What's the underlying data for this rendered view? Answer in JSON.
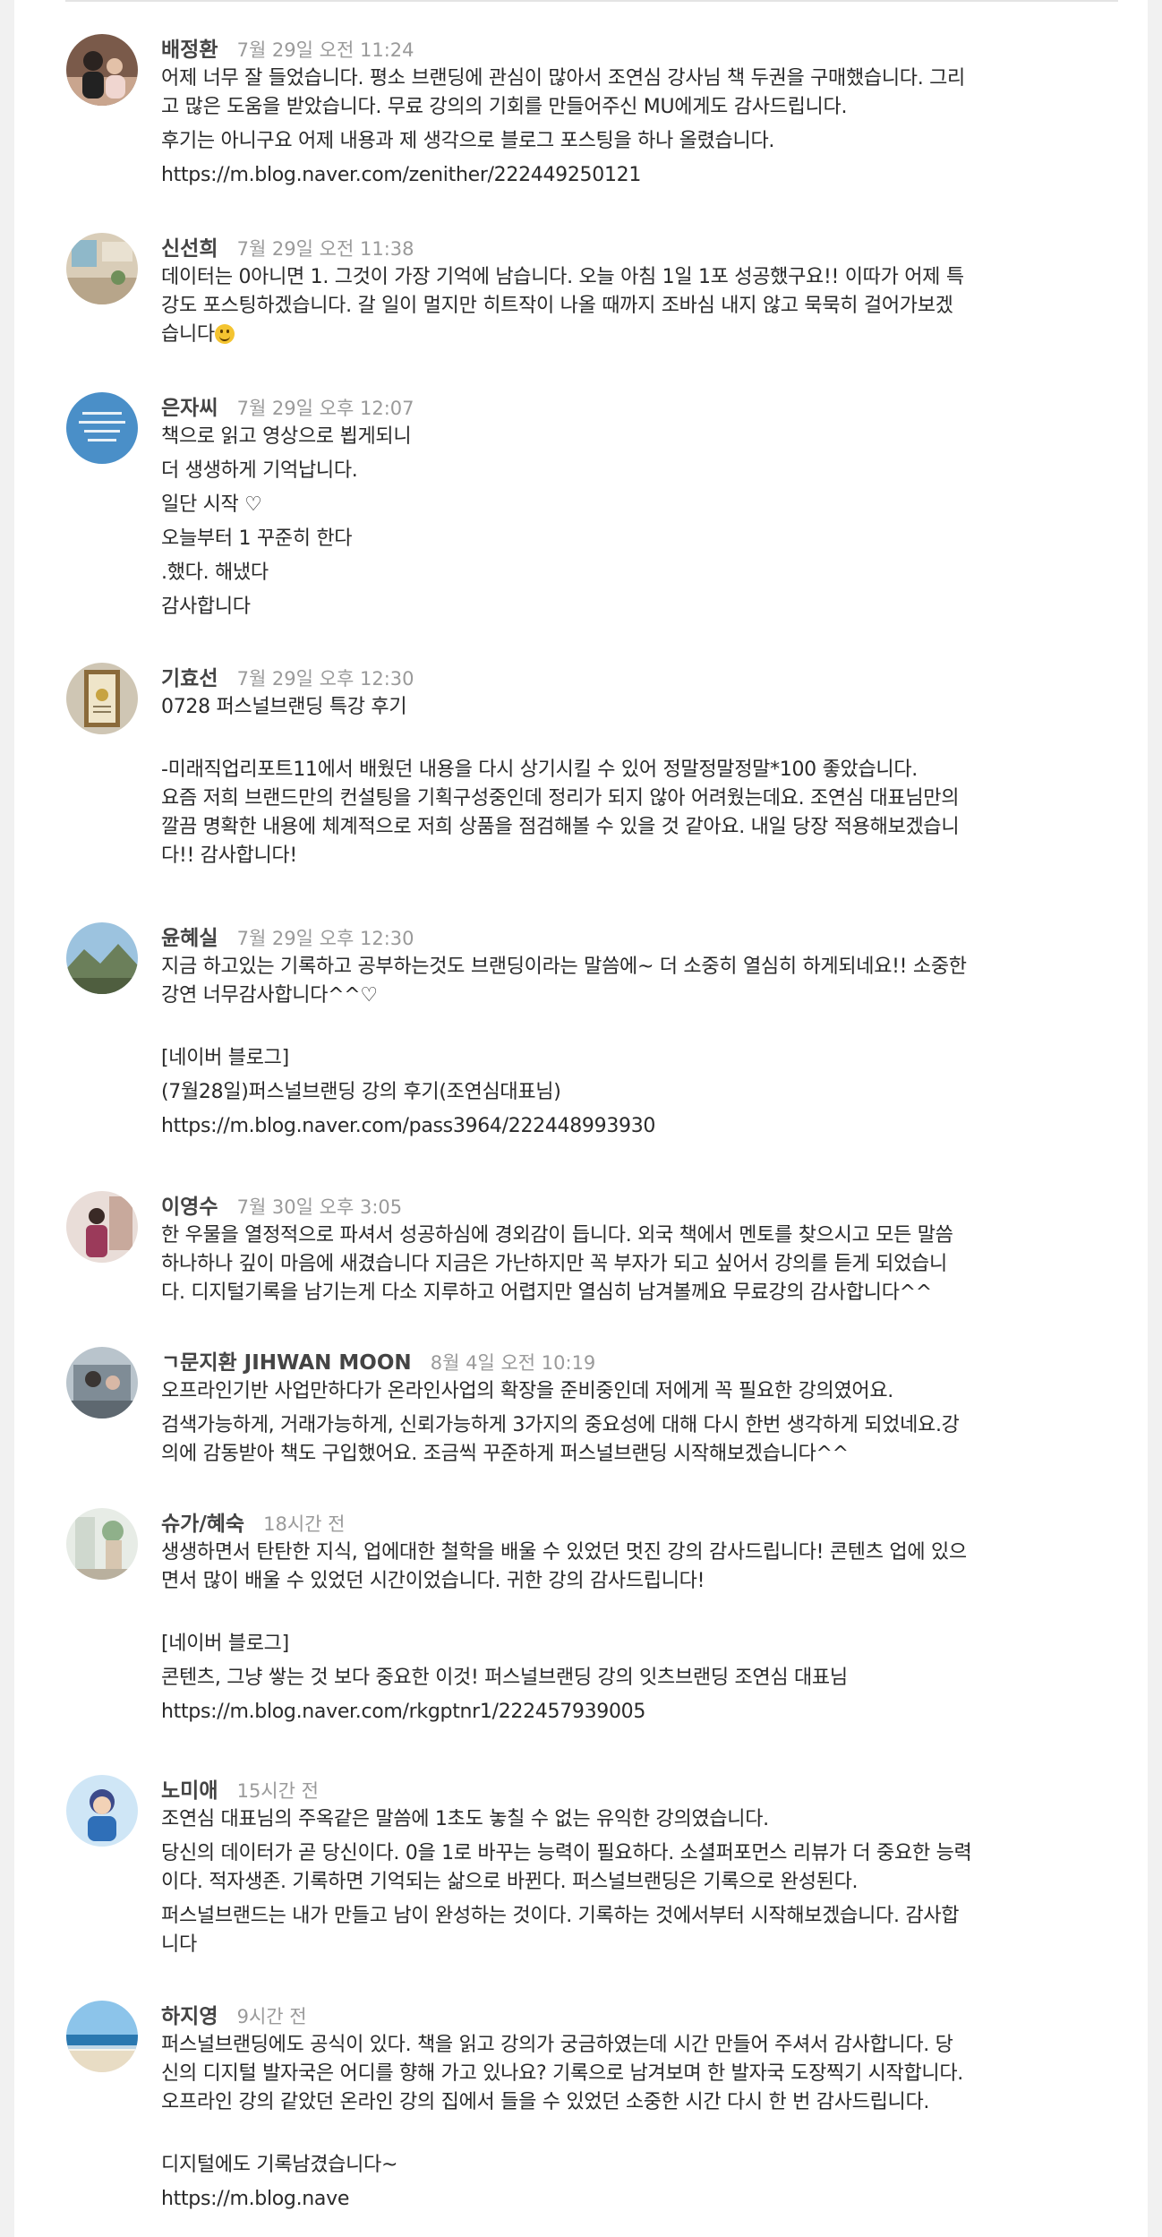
{
  "comments": [
    {
      "author": "배정환",
      "time": "7월 29일 오전 11:24",
      "paragraphs": [
        [
          "어제 너무 잘 들었습니다. 평소 브랜딩에 관심이 많아서 조연심 강사님 책 두권을 구매했습니다. 그리",
          "고 많은 도움을 받았습니다. 무료 강의의 기회를 만들어주신 MU에게도 감사드립니다."
        ],
        [
          "후기는 아니구요 어제 내용과 제 생각으로 블로그 포스팅을 하나 올렸습니다."
        ],
        [
          "https://m.blog.naver.com/zenither/222449250121"
        ]
      ]
    },
    {
      "author": "신선희",
      "time": "7월 29일 오전 11:38",
      "paragraphs": [
        [
          "데이터는 0아니면 1. 그것이 가장 기억에 남습니다. 오늘 아침 1일 1포 성공했구요!! 이따가 어제 특",
          "강도 포스팅하겠습니다. 갈 일이 멀지만 히트작이 나올 때까지 조바심 내지 않고 묵묵히 걸어가보겠",
          "습니다"
        ]
      ],
      "emoji": "grinning-face"
    },
    {
      "author": "은자씨",
      "time": "7월 29일 오후 12:07",
      "paragraphs": [
        [
          "책으로 읽고 영상으로 뵙게되니"
        ],
        [
          "더 생생하게 기억납니다."
        ],
        [
          "일단 시작 ♡"
        ],
        [
          "오늘부터 1 꾸준히 한다"
        ],
        [
          ".했다. 해냈다"
        ],
        [
          "감사합니다"
        ]
      ]
    },
    {
      "author": "기효선",
      "time": "7월 29일 오후 12:30",
      "paragraphs": [
        [
          "0728 퍼스널브랜딩 특강 후기"
        ],
        [
          "-미래직업리포트11에서 배웠던 내용을 다시 상기시킬 수 있어 정말정말정말*100 좋았습니다.",
          "요즘 저희 브랜드만의 컨설팅을 기획구성중인데 정리가 되지 않아 어려웠는데요. 조연심 대표님만의",
          "깔끔 명확한 내용에 체계적으로 저희 상품을 점검해볼 수 있을 것 같아요. 내일 당장 적용해보겠습니",
          "다!! 감사합니다!"
        ]
      ]
    },
    {
      "author": "윤혜실",
      "time": "7월 29일 오후 12:30",
      "paragraphs": [
        [
          "지금 하고있는 기록하고 공부하는것도 브랜딩이라는 말씀에~ 더 소중히 열심히 하게되네요!! 소중한",
          "강연 너무감사합니다^^♡"
        ],
        [
          "[네이버 블로그]"
        ],
        [
          "(7월28일)퍼스널브랜딩 강의 후기(조연심대표님)"
        ],
        [
          "https://m.blog.naver.com/pass3964/222448993930"
        ]
      ]
    },
    {
      "author": "이영수",
      "time": "7월 30일 오후 3:05",
      "paragraphs": [
        [
          "한 우물을 열정적으로 파셔서 성공하심에 경외감이 듭니다. 외국 책에서 멘토를 찾으시고 모든 말씀",
          "하나하나 깊이 마음에 새겼습니다 지금은 가난하지만 꼭 부자가 되고 싶어서 강의를 듣게 되었습니",
          "다. 디지털기록을 남기는게 다소 지루하고 어렵지만 열심히 남겨볼께요 무료강의 감사합니다^^"
        ]
      ]
    },
    {
      "author": "ㄱ문지환 JIHWAN MOON",
      "time": "8월 4일 오전 10:19",
      "paragraphs": [
        [
          "오프라인기반 사업만하다가 온라인사업의 확장을 준비중인데 저에게 꼭 필요한 강의였어요."
        ],
        [
          "검색가능하게, 거래가능하게, 신뢰가능하게 3가지의 중요성에 대해 다시 한번 생각하게 되었네요.강",
          "의에 감동받아 책도 구입했어요. 조금씩 꾸준하게 퍼스널브랜딩 시작해보겠습니다^^"
        ]
      ]
    },
    {
      "author": "슈가/혜숙",
      "time": "18시간 전",
      "paragraphs": [
        [
          "생생하면서 탄탄한 지식, 업에대한 철학을 배울 수 있었던 멋진 강의 감사드립니다! 콘텐츠 업에 있으",
          "면서 많이 배울 수 있었던 시간이었습니다. 귀한 강의 감사드립니다!"
        ],
        [
          "[네이버 블로그]"
        ],
        [
          "콘텐츠, 그냥 쌓는 것 보다 중요한 이것! 퍼스널브랜딩 강의 잇츠브랜딩 조연심 대표님"
        ],
        [
          "https://m.blog.naver.com/rkgptnr1/222457939005"
        ]
      ]
    },
    {
      "author": "노미애",
      "time": "15시간 전",
      "paragraphs": [
        [
          "조연심 대표님의 주옥같은 말씀에 1초도 놓칠 수 없는 유익한 강의였습니다."
        ],
        [
          "당신의 데이터가 곧 당신이다. 0을 1로 바꾸는 능력이 필요하다. 소셜퍼포먼스 리뷰가 더 중요한 능력",
          "이다. 적자생존. 기록하면 기억되는 삶으로 바뀐다. 퍼스널브랜딩은 기록으로 완성된다."
        ],
        [
          "퍼스널브랜드는 내가 만들고 남이 완성하는 것이다. 기록하는 것에서부터 시작해보겠습니다. 감사합",
          "니다"
        ]
      ]
    },
    {
      "author": "하지영",
      "time": "9시간 전",
      "paragraphs": [
        [
          "퍼스널브랜딩에도 공식이 있다. 책을 읽고 강의가 궁금하였는데 시간 만들어 주셔서 감사합니다. 당",
          "신의 디지털 발자국은 어디를 향해 가고 있나요? 기록으로 남겨보며 한 발자국 도장찍기 시작합니다.",
          "오프라인 강의 같았던 온라인 강의 집에서 들을 수 있었던 소중한 시간 다시 한 번 감사드립니다."
        ],
        [
          "디지털에도 기록남겼습니다~"
        ],
        [
          "https://m.blog.nave"
        ]
      ]
    }
  ]
}
